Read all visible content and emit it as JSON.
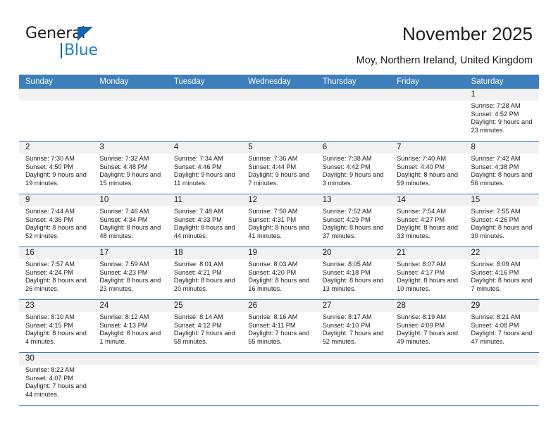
{
  "brand": {
    "name_top": "General",
    "name_bottom": "Blue",
    "accent_color": "#1263b0",
    "accent_light": "#1d7fd4"
  },
  "header": {
    "title": "November 2025",
    "subtitle": "Moy, Northern Ireland, United Kingdom"
  },
  "theme": {
    "header_row_bg": "#3d7ebd",
    "daynum_bg": "#f1f1f1",
    "grid_line": "#3d7ebd",
    "text": "#1b1b1b"
  },
  "weekdays": [
    "Sunday",
    "Monday",
    "Tuesday",
    "Wednesday",
    "Thursday",
    "Friday",
    "Saturday"
  ],
  "labels": {
    "sunrise": "Sunrise:",
    "sunset": "Sunset:",
    "daylight": "Daylight:"
  },
  "weeks": [
    [
      {
        "day": "",
        "empty": true
      },
      {
        "day": "",
        "empty": true
      },
      {
        "day": "",
        "empty": true
      },
      {
        "day": "",
        "empty": true
      },
      {
        "day": "",
        "empty": true
      },
      {
        "day": "",
        "empty": true
      },
      {
        "day": "1",
        "sunrise": "Sunrise: 7:28 AM",
        "sunset": "Sunset: 4:52 PM",
        "daylight": "Daylight: 9 hours and 23 minutes."
      }
    ],
    [
      {
        "day": "2",
        "sunrise": "Sunrise: 7:30 AM",
        "sunset": "Sunset: 4:50 PM",
        "daylight": "Daylight: 9 hours and 19 minutes."
      },
      {
        "day": "3",
        "sunrise": "Sunrise: 7:32 AM",
        "sunset": "Sunset: 4:48 PM",
        "daylight": "Daylight: 9 hours and 15 minutes."
      },
      {
        "day": "4",
        "sunrise": "Sunrise: 7:34 AM",
        "sunset": "Sunset: 4:46 PM",
        "daylight": "Daylight: 9 hours and 11 minutes."
      },
      {
        "day": "5",
        "sunrise": "Sunrise: 7:36 AM",
        "sunset": "Sunset: 4:44 PM",
        "daylight": "Daylight: 9 hours and 7 minutes."
      },
      {
        "day": "6",
        "sunrise": "Sunrise: 7:38 AM",
        "sunset": "Sunset: 4:42 PM",
        "daylight": "Daylight: 9 hours and 3 minutes."
      },
      {
        "day": "7",
        "sunrise": "Sunrise: 7:40 AM",
        "sunset": "Sunset: 4:40 PM",
        "daylight": "Daylight: 8 hours and 59 minutes."
      },
      {
        "day": "8",
        "sunrise": "Sunrise: 7:42 AM",
        "sunset": "Sunset: 4:38 PM",
        "daylight": "Daylight: 8 hours and 56 minutes."
      }
    ],
    [
      {
        "day": "9",
        "sunrise": "Sunrise: 7:44 AM",
        "sunset": "Sunset: 4:36 PM",
        "daylight": "Daylight: 8 hours and 52 minutes."
      },
      {
        "day": "10",
        "sunrise": "Sunrise: 7:46 AM",
        "sunset": "Sunset: 4:34 PM",
        "daylight": "Daylight: 8 hours and 48 minutes."
      },
      {
        "day": "11",
        "sunrise": "Sunrise: 7:48 AM",
        "sunset": "Sunset: 4:33 PM",
        "daylight": "Daylight: 8 hours and 44 minutes."
      },
      {
        "day": "12",
        "sunrise": "Sunrise: 7:50 AM",
        "sunset": "Sunset: 4:31 PM",
        "daylight": "Daylight: 8 hours and 41 minutes."
      },
      {
        "day": "13",
        "sunrise": "Sunrise: 7:52 AM",
        "sunset": "Sunset: 4:29 PM",
        "daylight": "Daylight: 8 hours and 37 minutes."
      },
      {
        "day": "14",
        "sunrise": "Sunrise: 7:54 AM",
        "sunset": "Sunset: 4:27 PM",
        "daylight": "Daylight: 8 hours and 33 minutes."
      },
      {
        "day": "15",
        "sunrise": "Sunrise: 7:55 AM",
        "sunset": "Sunset: 4:26 PM",
        "daylight": "Daylight: 8 hours and 30 minutes."
      }
    ],
    [
      {
        "day": "16",
        "sunrise": "Sunrise: 7:57 AM",
        "sunset": "Sunset: 4:24 PM",
        "daylight": "Daylight: 8 hours and 26 minutes."
      },
      {
        "day": "17",
        "sunrise": "Sunrise: 7:59 AM",
        "sunset": "Sunset: 4:23 PM",
        "daylight": "Daylight: 8 hours and 23 minutes."
      },
      {
        "day": "18",
        "sunrise": "Sunrise: 8:01 AM",
        "sunset": "Sunset: 4:21 PM",
        "daylight": "Daylight: 8 hours and 20 minutes."
      },
      {
        "day": "19",
        "sunrise": "Sunrise: 8:03 AM",
        "sunset": "Sunset: 4:20 PM",
        "daylight": "Daylight: 8 hours and 16 minutes."
      },
      {
        "day": "20",
        "sunrise": "Sunrise: 8:05 AM",
        "sunset": "Sunset: 4:18 PM",
        "daylight": "Daylight: 8 hours and 13 minutes."
      },
      {
        "day": "21",
        "sunrise": "Sunrise: 8:07 AM",
        "sunset": "Sunset: 4:17 PM",
        "daylight": "Daylight: 8 hours and 10 minutes."
      },
      {
        "day": "22",
        "sunrise": "Sunrise: 8:09 AM",
        "sunset": "Sunset: 4:16 PM",
        "daylight": "Daylight: 8 hours and 7 minutes."
      }
    ],
    [
      {
        "day": "23",
        "sunrise": "Sunrise: 8:10 AM",
        "sunset": "Sunset: 4:15 PM",
        "daylight": "Daylight: 8 hours and 4 minutes."
      },
      {
        "day": "24",
        "sunrise": "Sunrise: 8:12 AM",
        "sunset": "Sunset: 4:13 PM",
        "daylight": "Daylight: 8 hours and 1 minute."
      },
      {
        "day": "25",
        "sunrise": "Sunrise: 8:14 AM",
        "sunset": "Sunset: 4:12 PM",
        "daylight": "Daylight: 7 hours and 58 minutes."
      },
      {
        "day": "26",
        "sunrise": "Sunrise: 8:16 AM",
        "sunset": "Sunset: 4:11 PM",
        "daylight": "Daylight: 7 hours and 55 minutes."
      },
      {
        "day": "27",
        "sunrise": "Sunrise: 8:17 AM",
        "sunset": "Sunset: 4:10 PM",
        "daylight": "Daylight: 7 hours and 52 minutes."
      },
      {
        "day": "28",
        "sunrise": "Sunrise: 8:19 AM",
        "sunset": "Sunset: 4:09 PM",
        "daylight": "Daylight: 7 hours and 49 minutes."
      },
      {
        "day": "29",
        "sunrise": "Sunrise: 8:21 AM",
        "sunset": "Sunset: 4:08 PM",
        "daylight": "Daylight: 7 hours and 47 minutes."
      }
    ],
    [
      {
        "day": "30",
        "sunrise": "Sunrise: 8:22 AM",
        "sunset": "Sunset: 4:07 PM",
        "daylight": "Daylight: 7 hours and 44 minutes."
      },
      {
        "day": "",
        "empty": true
      },
      {
        "day": "",
        "empty": true
      },
      {
        "day": "",
        "empty": true
      },
      {
        "day": "",
        "empty": true
      },
      {
        "day": "",
        "empty": true
      },
      {
        "day": "",
        "empty": true
      }
    ]
  ]
}
